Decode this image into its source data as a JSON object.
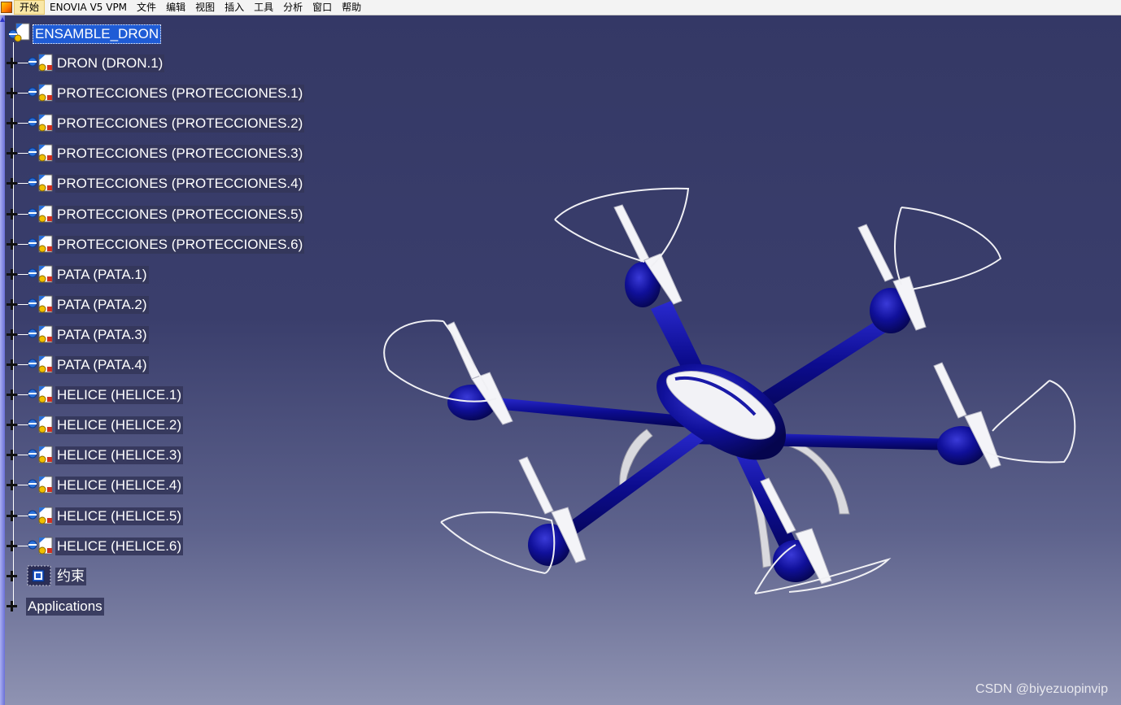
{
  "menubar": {
    "items": [
      "开始",
      "ENOVIA V5 VPM",
      "文件",
      "编辑",
      "视图",
      "插入",
      "工具",
      "分析",
      "窗口",
      "帮助"
    ]
  },
  "tree": {
    "root": "ENSAMBLE_DRON",
    "nodes": [
      "DRON (DRON.1)",
      "PROTECCIONES (PROTECCIONES.1)",
      "PROTECCIONES (PROTECCIONES.2)",
      "PROTECCIONES (PROTECCIONES.3)",
      "PROTECCIONES (PROTECCIONES.4)",
      "PROTECCIONES (PROTECCIONES.5)",
      "PROTECCIONES (PROTECCIONES.6)",
      "PATA (PATA.1)",
      "PATA (PATA.2)",
      "PATA (PATA.3)",
      "PATA (PATA.4)",
      "HELICE (HELICE.1)",
      "HELICE (HELICE.2)",
      "HELICE (HELICE.3)",
      "HELICE (HELICE.4)",
      "HELICE (HELICE.5)",
      "HELICE (HELICE.6)"
    ],
    "constraints": "约束",
    "applications": "Applications"
  },
  "icons": {
    "product": "product-icon",
    "constraints": "constraints-icon",
    "expand": "plus-expand-icon"
  },
  "colors": {
    "background_top": "#343865",
    "background_bottom": "#8f93b2",
    "model_blue": "#0b0b8a",
    "selection": "#1f5cd6"
  },
  "watermark": "CSDN @biyezuopinvip"
}
